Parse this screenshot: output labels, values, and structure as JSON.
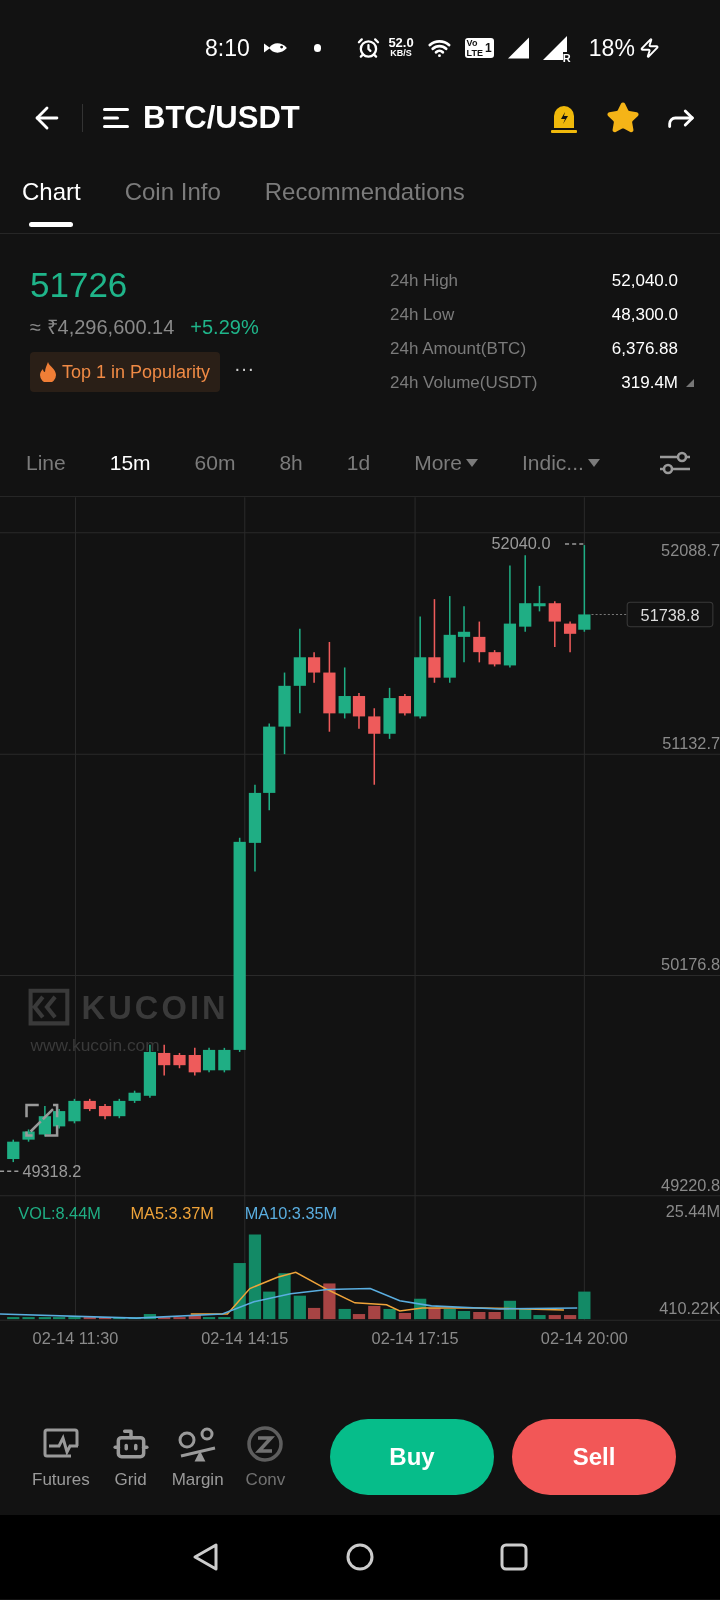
{
  "status_bar": {
    "time": "8:10",
    "speed": "52.0",
    "speed_unit": "KB/S",
    "volte_top": "Vo",
    "volte_bottom": "LTE",
    "sim": "1",
    "roaming": "R",
    "battery": "18%"
  },
  "header": {
    "title": "BTC/USDT",
    "favorited": true
  },
  "tabs": [
    {
      "label": "Chart",
      "selected": true
    },
    {
      "label": "Coin Info",
      "selected": false
    },
    {
      "label": "Recommendations",
      "selected": false
    }
  ],
  "ticker": {
    "price": "51726",
    "fiat": "≈ ₹4,296,600.14",
    "change": "+5.29%",
    "badge": "Top 1 in Popularity",
    "more": "···"
  },
  "stats": [
    {
      "label": "24h High",
      "value": "52,040.0"
    },
    {
      "label": "24h Low",
      "value": "48,300.0"
    },
    {
      "label": "24h Amount(BTC)",
      "value": "6,376.88"
    },
    {
      "label": "24h Volume(USDT)",
      "value": "319.4M",
      "kind": "toggle"
    }
  ],
  "periods": [
    {
      "label": "Line",
      "selected": false,
      "kind": "plain"
    },
    {
      "label": "15m",
      "selected": true,
      "kind": "plain"
    },
    {
      "label": "60m",
      "selected": false,
      "kind": "plain"
    },
    {
      "label": "8h",
      "selected": false,
      "kind": "plain"
    },
    {
      "label": "1d",
      "selected": false,
      "kind": "plain"
    },
    {
      "label": "More",
      "selected": false,
      "kind": "dropdown"
    },
    {
      "label": "Indic...",
      "selected": false,
      "kind": "dropdown"
    }
  ],
  "chart": {
    "price_axis": [
      "52088.7",
      "51132.7",
      "50176.8",
      "49220.8"
    ],
    "high_marker": "52040.0",
    "low_marker": "49318.2",
    "last_price": "51738.8",
    "watermark": "KUCOIN",
    "watermark_url": "www.kucoin.com",
    "volume_legend": [
      {
        "label": "VOL:8.44M",
        "color": "#1fae84"
      },
      {
        "label": "MA5:3.37M",
        "color": "#f0a43a"
      },
      {
        "label": "MA10:3.35M",
        "color": "#5aaee0"
      }
    ],
    "volume_axis": [
      "25.44M",
      "410.22K"
    ],
    "time_axis": [
      "02-14 11:30",
      "02-14 14:15",
      "02-14 17:15",
      "02-14 20:00"
    ]
  },
  "tools": [
    {
      "label": "Futures",
      "kind": "futures"
    },
    {
      "label": "Grid",
      "kind": "grid"
    },
    {
      "label": "Margin",
      "kind": "margin"
    },
    {
      "label": "Conv",
      "kind": "convert"
    }
  ],
  "actions": [
    {
      "label": "Buy",
      "kind": "buy"
    },
    {
      "label": "Sell",
      "kind": "sell"
    }
  ]
}
